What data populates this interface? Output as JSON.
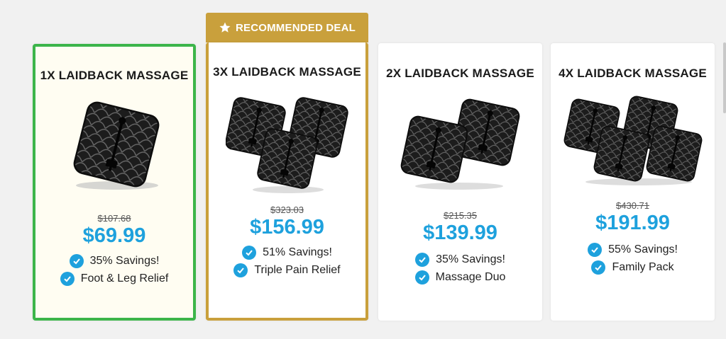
{
  "banner": {
    "label": "RECOMMENDED DEAL",
    "color": "#c9a03c"
  },
  "accent_color": "#1ea1dd",
  "selected_border_color": "#3cb54a",
  "packages": [
    {
      "title": "1X LAIDBACK MASSAGE",
      "old_price": "$107.68",
      "price": "$69.99",
      "features": [
        "35% Savings!",
        "Foot & Leg Relief"
      ],
      "image": "massager-pad-x1",
      "selected": true
    },
    {
      "title": "3X LAIDBACK MASSAGE",
      "old_price": "$323.03",
      "price": "$156.99",
      "features": [
        "51% Savings!",
        "Triple Pain Relief"
      ],
      "image": "massager-pad-x3",
      "recommended": true
    },
    {
      "title": "2X LAIDBACK MASSAGE",
      "old_price": "$215.35",
      "price": "$139.99",
      "features": [
        "35% Savings!",
        "Massage Duo"
      ],
      "image": "massager-pad-x2"
    },
    {
      "title": "4X LAIDBACK MASSAGE",
      "old_price": "$430.71",
      "price": "$191.99",
      "features": [
        "55% Savings!",
        "Family Pack"
      ],
      "image": "massager-pad-x4"
    }
  ]
}
